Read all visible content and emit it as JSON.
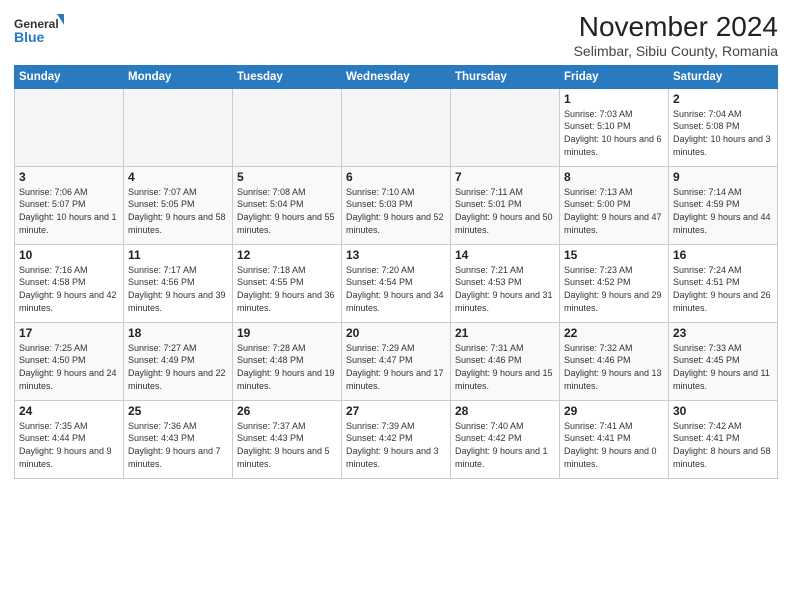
{
  "header": {
    "title": "November 2024",
    "subtitle": "Selimbar, Sibiu County, Romania",
    "logo_line1": "General",
    "logo_line2": "Blue"
  },
  "calendar": {
    "headers": [
      "Sunday",
      "Monday",
      "Tuesday",
      "Wednesday",
      "Thursday",
      "Friday",
      "Saturday"
    ],
    "weeks": [
      [
        {
          "day": "",
          "info": ""
        },
        {
          "day": "",
          "info": ""
        },
        {
          "day": "",
          "info": ""
        },
        {
          "day": "",
          "info": ""
        },
        {
          "day": "",
          "info": ""
        },
        {
          "day": "1",
          "info": "Sunrise: 7:03 AM\nSunset: 5:10 PM\nDaylight: 10 hours and 6 minutes."
        },
        {
          "day": "2",
          "info": "Sunrise: 7:04 AM\nSunset: 5:08 PM\nDaylight: 10 hours and 3 minutes."
        }
      ],
      [
        {
          "day": "3",
          "info": "Sunrise: 7:06 AM\nSunset: 5:07 PM\nDaylight: 10 hours and 1 minute."
        },
        {
          "day": "4",
          "info": "Sunrise: 7:07 AM\nSunset: 5:05 PM\nDaylight: 9 hours and 58 minutes."
        },
        {
          "day": "5",
          "info": "Sunrise: 7:08 AM\nSunset: 5:04 PM\nDaylight: 9 hours and 55 minutes."
        },
        {
          "day": "6",
          "info": "Sunrise: 7:10 AM\nSunset: 5:03 PM\nDaylight: 9 hours and 52 minutes."
        },
        {
          "day": "7",
          "info": "Sunrise: 7:11 AM\nSunset: 5:01 PM\nDaylight: 9 hours and 50 minutes."
        },
        {
          "day": "8",
          "info": "Sunrise: 7:13 AM\nSunset: 5:00 PM\nDaylight: 9 hours and 47 minutes."
        },
        {
          "day": "9",
          "info": "Sunrise: 7:14 AM\nSunset: 4:59 PM\nDaylight: 9 hours and 44 minutes."
        }
      ],
      [
        {
          "day": "10",
          "info": "Sunrise: 7:16 AM\nSunset: 4:58 PM\nDaylight: 9 hours and 42 minutes."
        },
        {
          "day": "11",
          "info": "Sunrise: 7:17 AM\nSunset: 4:56 PM\nDaylight: 9 hours and 39 minutes."
        },
        {
          "day": "12",
          "info": "Sunrise: 7:18 AM\nSunset: 4:55 PM\nDaylight: 9 hours and 36 minutes."
        },
        {
          "day": "13",
          "info": "Sunrise: 7:20 AM\nSunset: 4:54 PM\nDaylight: 9 hours and 34 minutes."
        },
        {
          "day": "14",
          "info": "Sunrise: 7:21 AM\nSunset: 4:53 PM\nDaylight: 9 hours and 31 minutes."
        },
        {
          "day": "15",
          "info": "Sunrise: 7:23 AM\nSunset: 4:52 PM\nDaylight: 9 hours and 29 minutes."
        },
        {
          "day": "16",
          "info": "Sunrise: 7:24 AM\nSunset: 4:51 PM\nDaylight: 9 hours and 26 minutes."
        }
      ],
      [
        {
          "day": "17",
          "info": "Sunrise: 7:25 AM\nSunset: 4:50 PM\nDaylight: 9 hours and 24 minutes."
        },
        {
          "day": "18",
          "info": "Sunrise: 7:27 AM\nSunset: 4:49 PM\nDaylight: 9 hours and 22 minutes."
        },
        {
          "day": "19",
          "info": "Sunrise: 7:28 AM\nSunset: 4:48 PM\nDaylight: 9 hours and 19 minutes."
        },
        {
          "day": "20",
          "info": "Sunrise: 7:29 AM\nSunset: 4:47 PM\nDaylight: 9 hours and 17 minutes."
        },
        {
          "day": "21",
          "info": "Sunrise: 7:31 AM\nSunset: 4:46 PM\nDaylight: 9 hours and 15 minutes."
        },
        {
          "day": "22",
          "info": "Sunrise: 7:32 AM\nSunset: 4:46 PM\nDaylight: 9 hours and 13 minutes."
        },
        {
          "day": "23",
          "info": "Sunrise: 7:33 AM\nSunset: 4:45 PM\nDaylight: 9 hours and 11 minutes."
        }
      ],
      [
        {
          "day": "24",
          "info": "Sunrise: 7:35 AM\nSunset: 4:44 PM\nDaylight: 9 hours and 9 minutes."
        },
        {
          "day": "25",
          "info": "Sunrise: 7:36 AM\nSunset: 4:43 PM\nDaylight: 9 hours and 7 minutes."
        },
        {
          "day": "26",
          "info": "Sunrise: 7:37 AM\nSunset: 4:43 PM\nDaylight: 9 hours and 5 minutes."
        },
        {
          "day": "27",
          "info": "Sunrise: 7:39 AM\nSunset: 4:42 PM\nDaylight: 9 hours and 3 minutes."
        },
        {
          "day": "28",
          "info": "Sunrise: 7:40 AM\nSunset: 4:42 PM\nDaylight: 9 hours and 1 minute."
        },
        {
          "day": "29",
          "info": "Sunrise: 7:41 AM\nSunset: 4:41 PM\nDaylight: 9 hours and 0 minutes."
        },
        {
          "day": "30",
          "info": "Sunrise: 7:42 AM\nSunset: 4:41 PM\nDaylight: 8 hours and 58 minutes."
        }
      ]
    ]
  }
}
